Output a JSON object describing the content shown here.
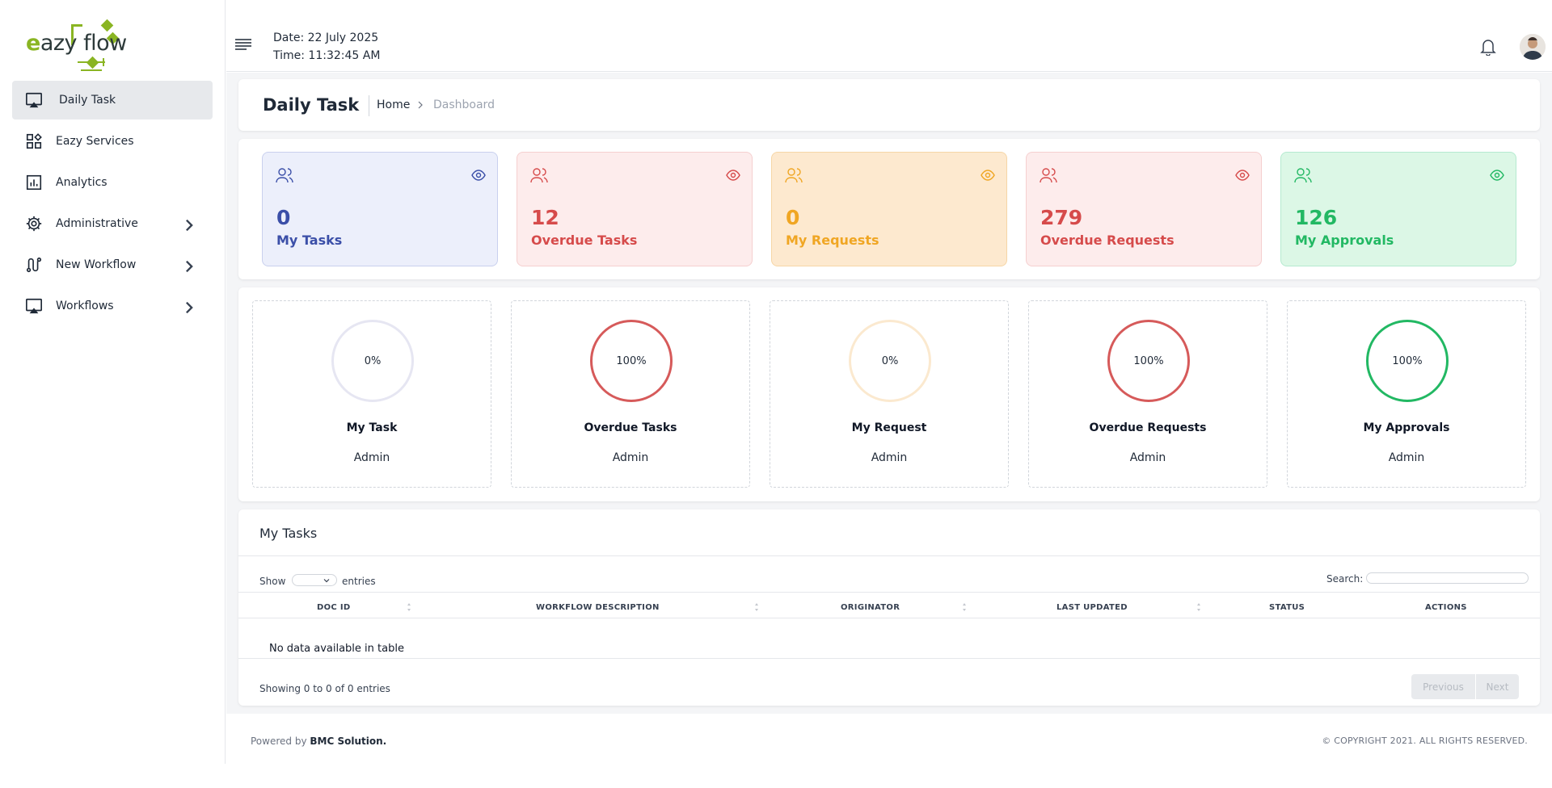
{
  "brand": {
    "logo_text_prefix": "e",
    "logo_text_rest": "azy flow"
  },
  "sidebar": {
    "items": [
      {
        "label": "Daily Task",
        "icon": "monitor-icon",
        "active": true,
        "has_submenu": false
      },
      {
        "label": "Eazy Services",
        "icon": "grid-icon",
        "active": false,
        "has_submenu": false
      },
      {
        "label": "Analytics",
        "icon": "chart-icon",
        "active": false,
        "has_submenu": false
      },
      {
        "label": "Administrative",
        "icon": "gear-icon",
        "active": false,
        "has_submenu": true
      },
      {
        "label": "New Workflow",
        "icon": "route-icon",
        "active": false,
        "has_submenu": true
      },
      {
        "label": "Workflows",
        "icon": "monitor-icon",
        "active": false,
        "has_submenu": true
      }
    ]
  },
  "topbar": {
    "date_text": "Date: 22 July 2025",
    "time_text": "Time:  11:32:45 AM"
  },
  "page": {
    "title": "Daily Task",
    "breadcrumb_home": "Home",
    "breadcrumb_current": "Dashboard"
  },
  "stats": [
    {
      "value": "0",
      "label": "My Tasks",
      "color": "#3b4fa8",
      "bg": "#eceffb",
      "border": "#c9d0ee"
    },
    {
      "value": "12",
      "label": "Overdue Tasks",
      "color": "#d64b4b",
      "bg": "#fdecec",
      "border": "#f5cfcf"
    },
    {
      "value": "0",
      "label": "My Requests",
      "color": "#f0a623",
      "bg": "#fde9cf",
      "border": "#f6d6a6"
    },
    {
      "value": "279",
      "label": "Overdue Requests",
      "color": "#d64b4b",
      "bg": "#fdecec",
      "border": "#f5cfcf"
    },
    {
      "value": "126",
      "label": "My Approvals",
      "color": "#22b863",
      "bg": "#dcf7e6",
      "border": "#b5ead0"
    }
  ],
  "rings": [
    {
      "percent": "0%",
      "title": "My Task",
      "sub": "Admin",
      "color": "#e6e6f2"
    },
    {
      "percent": "100%",
      "title": "Overdue Tasks",
      "sub": "Admin",
      "color": "#d65a5a"
    },
    {
      "percent": "0%",
      "title": "My Request",
      "sub": "Admin",
      "color": "#fbe9cf"
    },
    {
      "percent": "100%",
      "title": "Overdue Requests",
      "sub": "Admin",
      "color": "#d65a5a"
    },
    {
      "percent": "100%",
      "title": "My Approvals",
      "sub": "Admin",
      "color": "#22b863"
    }
  ],
  "table": {
    "title": "My Tasks",
    "show_label": "Show",
    "entries_label": "entries",
    "search_label": "Search:",
    "columns": [
      "DOC ID",
      "WORKFLOW DESCRIPTION",
      "ORIGINATOR",
      "LAST UPDATED",
      "STATUS",
      "ACTIONS"
    ],
    "empty_text": "No data available in table",
    "info_text": "Showing 0 to 0 of 0 entries",
    "prev_label": "Previous",
    "next_label": "Next"
  },
  "footer": {
    "powered_prefix": "Powered by ",
    "powered_brand": "BMC Solution.",
    "copyright": "© COPYRIGHT 2021. ALL RIGHTS RESERVED."
  }
}
